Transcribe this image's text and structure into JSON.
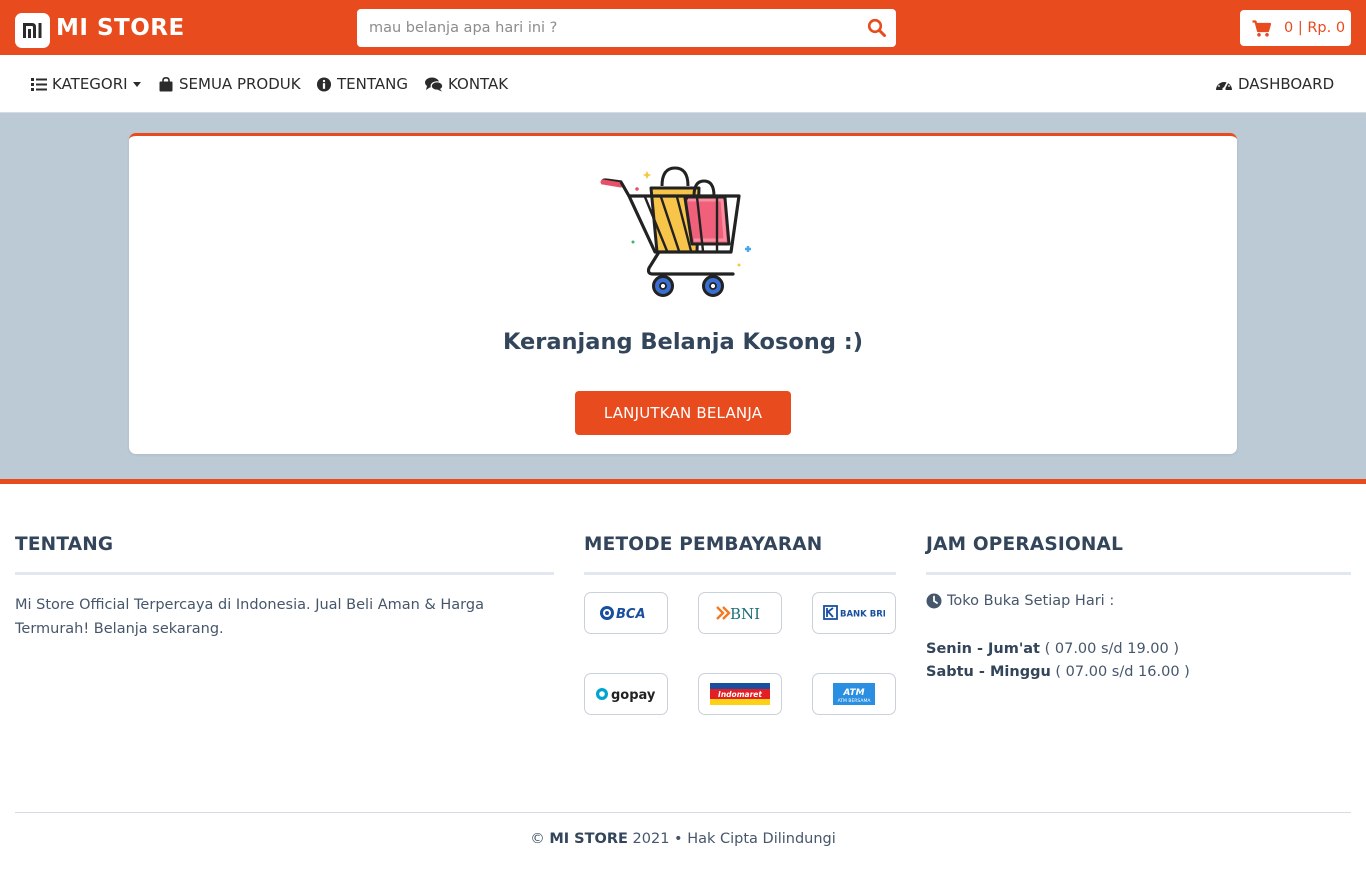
{
  "header": {
    "brand": "MI STORE",
    "search_placeholder": "mau belanja apa hari ini ?",
    "cart_summary": "0 | Rp. 0"
  },
  "nav": {
    "kategori": "KATEGORI",
    "semua_produk": "SEMUA PRODUK",
    "tentang": "TENTANG",
    "kontak": "KONTAK",
    "dashboard": "DASHBOARD"
  },
  "cart": {
    "empty_title": "Keranjang Belanja Kosong :)",
    "continue_label": "LANJUTKAN BELANJA"
  },
  "footer": {
    "about": {
      "heading": "TENTANG",
      "text": "Mi Store Official Terpercaya di Indonesia. Jual Beli Aman & Harga Termurah! Belanja sekarang."
    },
    "payment": {
      "heading": "METODE PEMBAYARAN",
      "methods": [
        "BCA",
        "BNI",
        "BANK BRI",
        "gopay",
        "Indomaret",
        "ATM BERSAMA"
      ]
    },
    "hours": {
      "heading": "JAM OPERASIONAL",
      "intro": "Toko Buka Setiap Hari :",
      "weekday_label": "Senin - Jum'at",
      "weekday_time": " ( 07.00 s/d 19.00 )",
      "weekend_label": "Sabtu - Minggu",
      "weekend_time": " ( 07.00 s/d 16.00 )"
    },
    "copyright": {
      "symbol": "© ",
      "brand": "MI STORE",
      "rest": " 2021 • Hak Cipta Dilindungi"
    }
  },
  "colors": {
    "brand_orange": "#e84c1e",
    "band_gray": "#bccad6",
    "heading_navy": "#33455a"
  }
}
